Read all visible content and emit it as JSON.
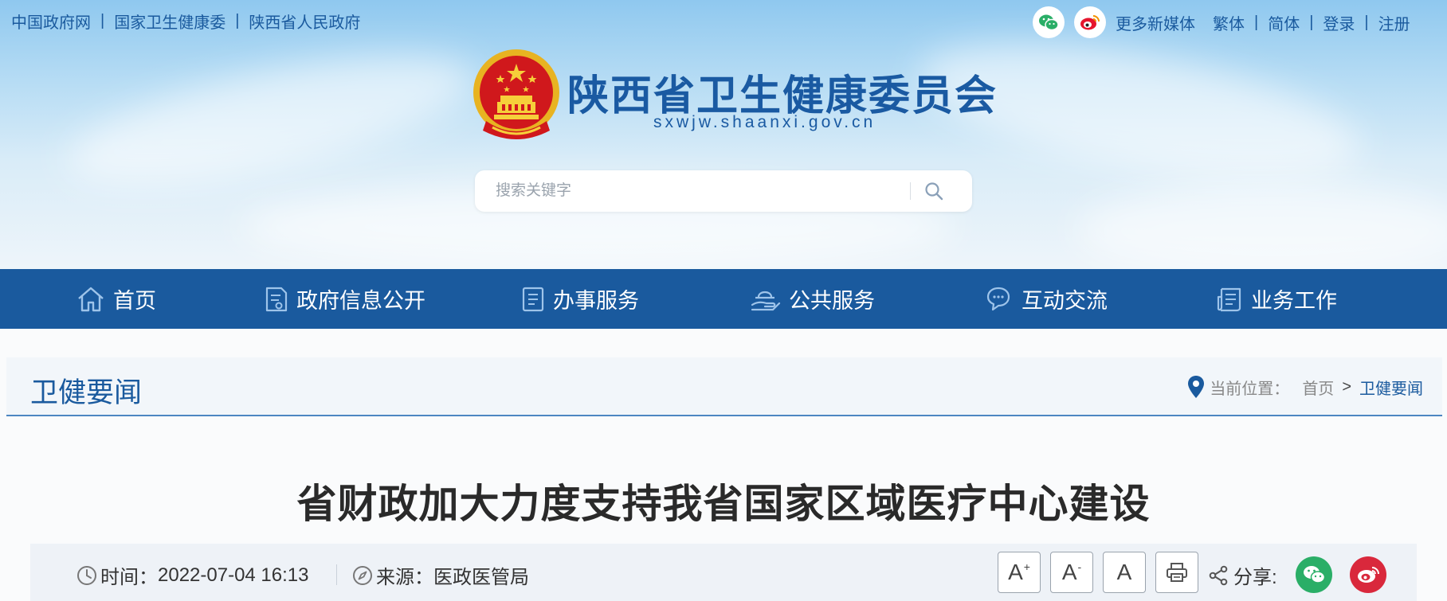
{
  "top_links": [
    "中国政府网",
    "国家卫生健康委",
    "陕西省人民政府"
  ],
  "top_right": {
    "more_media": "更多新媒体",
    "traditional": "繁体",
    "simplified": "简体",
    "login": "登录",
    "register": "注册"
  },
  "site": {
    "title": "陕西省卫生健康委员会",
    "url": "sxwjw.shaanxi.gov.cn"
  },
  "search": {
    "placeholder": "搜索关键字"
  },
  "nav": [
    {
      "label": "首页",
      "icon": "home-icon"
    },
    {
      "label": "政府信息公开",
      "icon": "document-icon"
    },
    {
      "label": "办事服务",
      "icon": "clipboard-icon"
    },
    {
      "label": "公共服务",
      "icon": "hand-service-icon"
    },
    {
      "label": "互动交流",
      "icon": "chat-icon"
    },
    {
      "label": "业务工作",
      "icon": "newspaper-icon"
    }
  ],
  "section": {
    "title": "卫健要闻"
  },
  "breadcrumb": {
    "label": "当前位置：",
    "home": "首页",
    "separator": ">",
    "current": "卫健要闻"
  },
  "article": {
    "title": "省财政加大力度支持我省国家区域医疗中心建设",
    "time_label": "时间：",
    "time": "2022-07-04 16:13",
    "source_label": "来源：",
    "source": "医政医管局"
  },
  "tools": {
    "font_large": "A",
    "font_large_sup": "+",
    "font_small": "A",
    "font_small_sup": "-",
    "font_normal": "A",
    "share_label": "分享:"
  },
  "colors": {
    "brand_blue": "#1a5a9e",
    "wechat_green": "#2aae67",
    "weibo_red": "#d9283c"
  }
}
